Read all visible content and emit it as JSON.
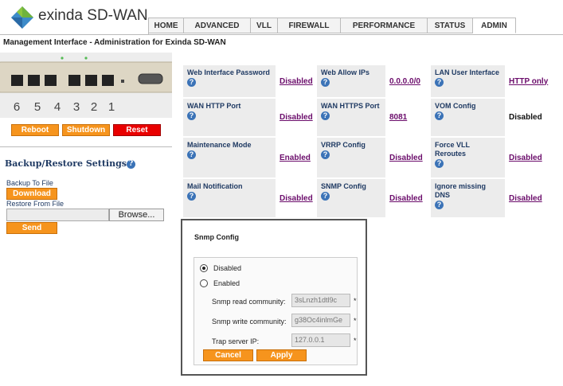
{
  "brand": {
    "name": "exinda SD-WAN"
  },
  "nav": {
    "tabs": [
      "HOME",
      "ADVANCED",
      "VLL",
      "FIREWALL",
      "PERFORMANCE",
      "STATUS",
      "ADMIN"
    ],
    "active": "ADMIN"
  },
  "page": {
    "title": "Management Interface - Administration for Exinda SD-WAN"
  },
  "device": {
    "port_numbers": [
      "6",
      "5",
      "4",
      "3",
      "2",
      "1"
    ]
  },
  "actions": {
    "reboot": "Reboot",
    "shutdown": "Shutdown",
    "reset": "Reset"
  },
  "backup": {
    "title": "Backup/Restore Settings",
    "backup_to_file": "Backup To File",
    "download": "Download",
    "restore_from_file": "Restore From File",
    "browse": "Browse...",
    "send": "Send"
  },
  "settings": [
    [
      {
        "label": "Web Interface Password",
        "value": "Disabled",
        "link": true
      },
      {
        "label": "Web Allow IPs",
        "value": "0.0.0.0/0",
        "link": true
      },
      {
        "label": "LAN User Interface",
        "value": "HTTP only",
        "link": true
      }
    ],
    [
      {
        "label": "WAN HTTP Port",
        "value": "Disabled",
        "link": true
      },
      {
        "label": "WAN HTTPS Port",
        "value": "8081",
        "link": true
      },
      {
        "label": "VOM Config",
        "value": "Disabled",
        "link": false
      }
    ],
    [
      {
        "label": "Maintenance Mode",
        "value": "Enabled",
        "link": true
      },
      {
        "label": "VRRP Config",
        "value": "Disabled",
        "link": true
      },
      {
        "label": "Force VLL Reroutes",
        "value": "Disabled",
        "link": true
      }
    ],
    [
      {
        "label": "Mail Notification",
        "value": "Disabled",
        "link": true
      },
      {
        "label": "SNMP Config",
        "value": "Disabled",
        "link": true
      },
      {
        "label": "Ignore missing DNS",
        "value": "Disabled",
        "link": true
      }
    ]
  ],
  "snmp_dialog": {
    "title": "Snmp Config",
    "option_disabled": "Disabled",
    "option_enabled": "Enabled",
    "selected": "Disabled",
    "read_label": "Snmp read community:",
    "read_value": "3sLnzh1dtl9c",
    "write_label": "Snmp write community:",
    "write_value": "g38Oc4inlmGe",
    "trap_label": "Trap server IP:",
    "trap_value": "127.0.0.1",
    "required_mark": "*",
    "cancel": "Cancel",
    "apply": "Apply"
  },
  "colors": {
    "accent": "#f6941d",
    "danger": "#e90000",
    "link": "#6b0c6b",
    "help": "#3b73b7"
  }
}
